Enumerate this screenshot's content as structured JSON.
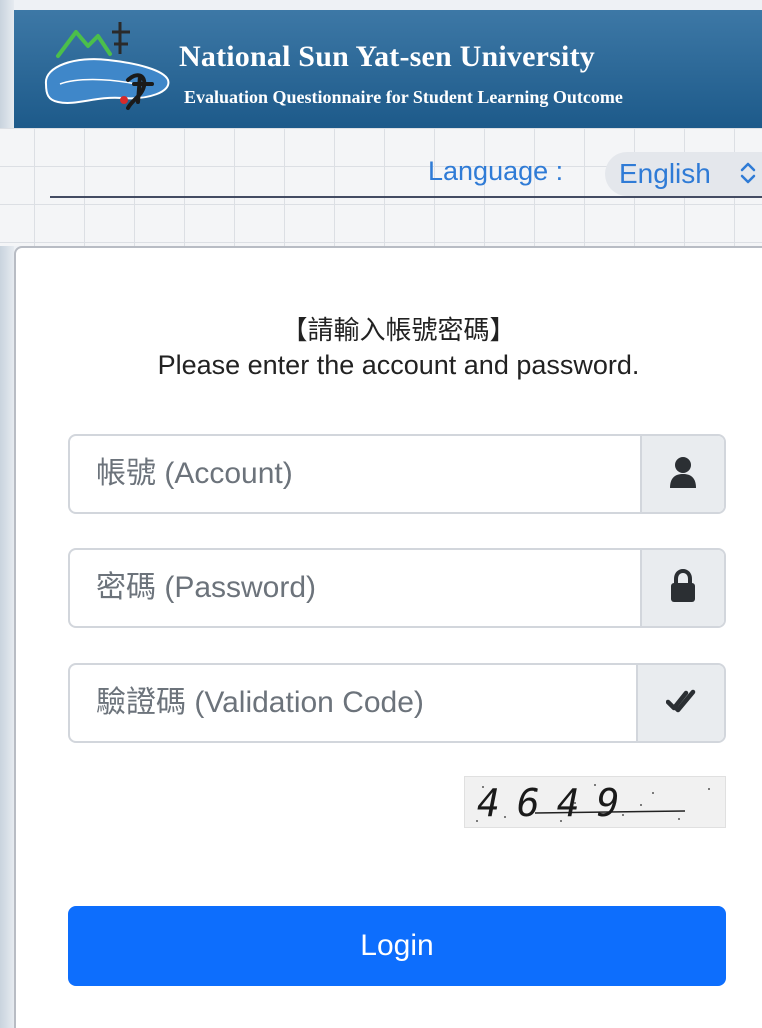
{
  "header": {
    "title": "National Sun Yat-sen University",
    "subtitle": "Evaluation Questionnaire for Student Learning Outcome",
    "logo_icon": "nsysu-logo-icon",
    "background_color": "#1d5a8a"
  },
  "language": {
    "label": "Language :",
    "selected": "English",
    "chevron_icon": "chevron-up-down-icon"
  },
  "login_card": {
    "title_zh": "【請輸入帳號密碼】",
    "title_en": "Please enter the account and password.",
    "account": {
      "placeholder": "帳號 (Account)",
      "value": "",
      "icon": "user-icon"
    },
    "password": {
      "placeholder": "密碼 (Password)",
      "value": "",
      "icon": "lock-icon"
    },
    "validation_code": {
      "placeholder": "驗證碼 (Validation Code)",
      "value": "",
      "icon": "double-check-icon"
    },
    "captcha_text": "4649",
    "login_label": "Login",
    "accent_color": "#0d6efd"
  }
}
